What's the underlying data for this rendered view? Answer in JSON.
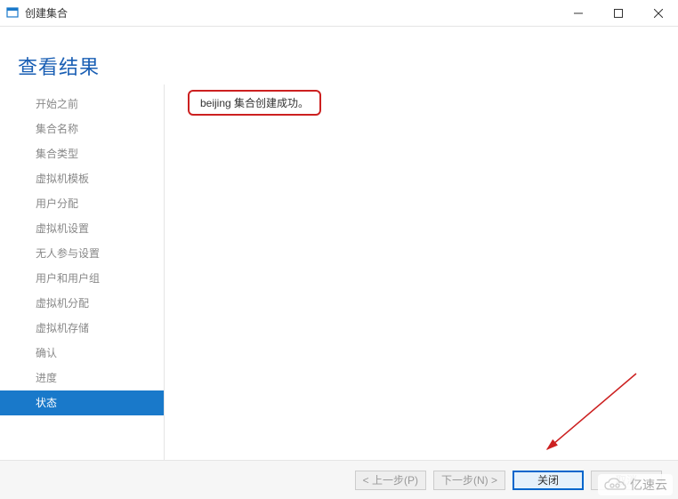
{
  "titlebar": {
    "title": "创建集合"
  },
  "header": {
    "title": "查看结果"
  },
  "sidebar": {
    "items": [
      {
        "label": "开始之前",
        "selected": false
      },
      {
        "label": "集合名称",
        "selected": false
      },
      {
        "label": "集合类型",
        "selected": false
      },
      {
        "label": "虚拟机模板",
        "selected": false
      },
      {
        "label": "用户分配",
        "selected": false
      },
      {
        "label": "虚拟机设置",
        "selected": false
      },
      {
        "label": "无人参与设置",
        "selected": false
      },
      {
        "label": "用户和用户组",
        "selected": false
      },
      {
        "label": "虚拟机分配",
        "selected": false
      },
      {
        "label": "虚拟机存储",
        "selected": false
      },
      {
        "label": "确认",
        "selected": false
      },
      {
        "label": "进度",
        "selected": false
      },
      {
        "label": "状态",
        "selected": true
      }
    ]
  },
  "main": {
    "status_message": "beijing 集合创建成功。"
  },
  "footer": {
    "prev_label": "< 上一步(P)",
    "next_label": "下一步(N) >",
    "close_label": "关闭",
    "cancel_label": "取消"
  },
  "watermark": {
    "text": "亿速云"
  }
}
